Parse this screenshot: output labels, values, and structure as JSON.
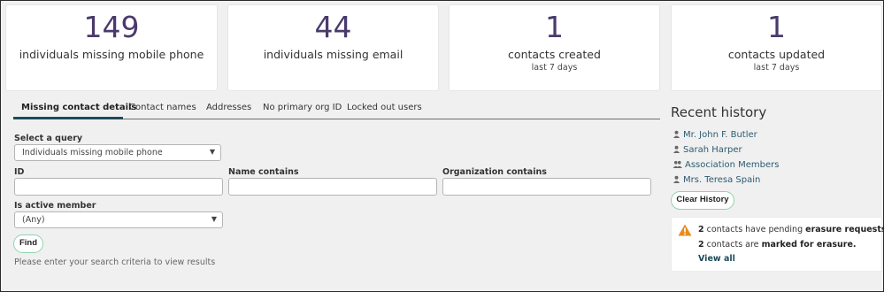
{
  "stats": [
    {
      "value": "149",
      "label": "individuals missing mobile phone",
      "sub": ""
    },
    {
      "value": "44",
      "label": "individuals missing email",
      "sub": ""
    },
    {
      "value": "1",
      "label": "contacts created",
      "sub": "last 7 days"
    },
    {
      "value": "1",
      "label": "contacts updated",
      "sub": "last 7 days"
    }
  ],
  "tabs": [
    {
      "label": "Missing contact details",
      "active": true
    },
    {
      "label": "Contact names",
      "active": false
    },
    {
      "label": "Addresses",
      "active": false
    },
    {
      "label": "No primary org ID",
      "active": false
    },
    {
      "label": "Locked out users",
      "active": false
    }
  ],
  "query": {
    "label": "Select a query",
    "value": "Individuals missing mobile phone"
  },
  "filters": {
    "id_label": "ID",
    "id_value": "",
    "name_label": "Name contains",
    "name_value": "",
    "org_label": "Organization contains",
    "org_value": "",
    "active_label": "Is active member",
    "active_value": "(Any)"
  },
  "find_label": "Find",
  "hint": "Please enter your search criteria to view results",
  "recent_history": {
    "title": "Recent history",
    "items": [
      {
        "label": "Mr. John F. Butler",
        "icon": "person-icon"
      },
      {
        "label": "Sarah Harper",
        "icon": "person-icon"
      },
      {
        "label": "Association Members",
        "icon": "group-icon"
      },
      {
        "label": "Mrs. Teresa Spain",
        "icon": "person-icon"
      }
    ],
    "clear_label": "Clear History"
  },
  "alert": {
    "line1_count": "2",
    "line1_text": " contacts have pending ",
    "line1_bold": "erasure requests.",
    "line2_count": "2",
    "line2_text": " contacts are ",
    "line2_bold": "marked for erasure.",
    "link": "View all",
    "icon": "warning-icon",
    "icon_color": "#e98a1c"
  },
  "colors": {
    "stat_number": "#4a3a6b",
    "link": "#2b5b72",
    "pill_border": "#8fd3b0",
    "tab_underline": "#1d4a5a"
  }
}
